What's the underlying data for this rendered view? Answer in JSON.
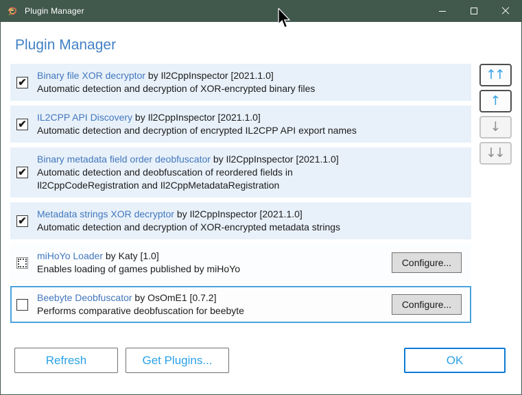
{
  "titlebar": {
    "title": "Plugin Manager",
    "app_icon": "rose-scribble-icon",
    "minimize_icon": "minimize",
    "maximize_icon": "maximize",
    "close_icon": "close"
  },
  "header": {
    "title": "Plugin Manager"
  },
  "check_glyph": "✔",
  "configure_label": "Configure...",
  "plugins": [
    {
      "name": "Binary file XOR decryptor",
      "byline": "by Il2CppInspector [2021.1.0]",
      "description": "Automatic detection and decryption of XOR-encrypted binary files",
      "checkbox_state": "checked",
      "check_glyph": "✔",
      "has_configure": false,
      "selected": false
    },
    {
      "name": "IL2CPP API Discovery",
      "byline": "by Il2CppInspector [2021.1.0]",
      "description": "Automatic detection and decryption of encrypted IL2CPP API export names",
      "checkbox_state": "checked",
      "check_glyph": "✔",
      "has_configure": false,
      "selected": false
    },
    {
      "name": "Binary metadata field order deobfuscator",
      "byline": "by Il2CppInspector [2021.1.0]",
      "description": "Automatic detection and deobfuscation of reordered fields in Il2CppCodeRegistration and Il2CppMetadataRegistration",
      "checkbox_state": "checked",
      "check_glyph": "✔",
      "has_configure": false,
      "selected": false
    },
    {
      "name": "Metadata strings XOR decryptor",
      "byline": "by Il2CppInspector [2021.1.0]",
      "description": "Automatic detection and decryption of XOR-encrypted metadata strings",
      "checkbox_state": "checked",
      "check_glyph": "✔",
      "has_configure": false,
      "selected": false
    },
    {
      "name": "miHoYo Loader",
      "byline": "by Katy [1.0]",
      "description": "Enables loading of games published by miHoYo",
      "checkbox_state": "unchecked-focus-dotted",
      "check_glyph": "",
      "has_configure": true,
      "selected": false
    },
    {
      "name": "Beebyte Deobfuscator",
      "byline": "by OsOmE1 [0.7.2]",
      "description": "Performs comparative deobfuscation for beebyte",
      "checkbox_state": "unchecked",
      "check_glyph": "",
      "has_configure": true,
      "selected": true
    }
  ],
  "reorder": {
    "move_to_top": {
      "glyph": "↑↑",
      "enabled": true
    },
    "move_up": {
      "glyph": "↑",
      "enabled": true
    },
    "move_down": {
      "glyph": "↓",
      "enabled": false
    },
    "move_to_bottom": {
      "glyph": "↓↓",
      "enabled": false
    }
  },
  "footer": {
    "refresh_label": "Refresh",
    "get_plugins_label": "Get Plugins...",
    "ok_label": "OK"
  },
  "colors": {
    "titlebar_bg": "#41584d",
    "heading_blue": "#4181c4",
    "link_blue": "#4277bd",
    "enabled_row_bg": "#e8f1fa",
    "selected_row_border": "#4aa3dd",
    "footer_text_blue": "#2aa1e6",
    "ok_border_blue": "#0d7ad4",
    "configure_bg": "#dddddd"
  }
}
